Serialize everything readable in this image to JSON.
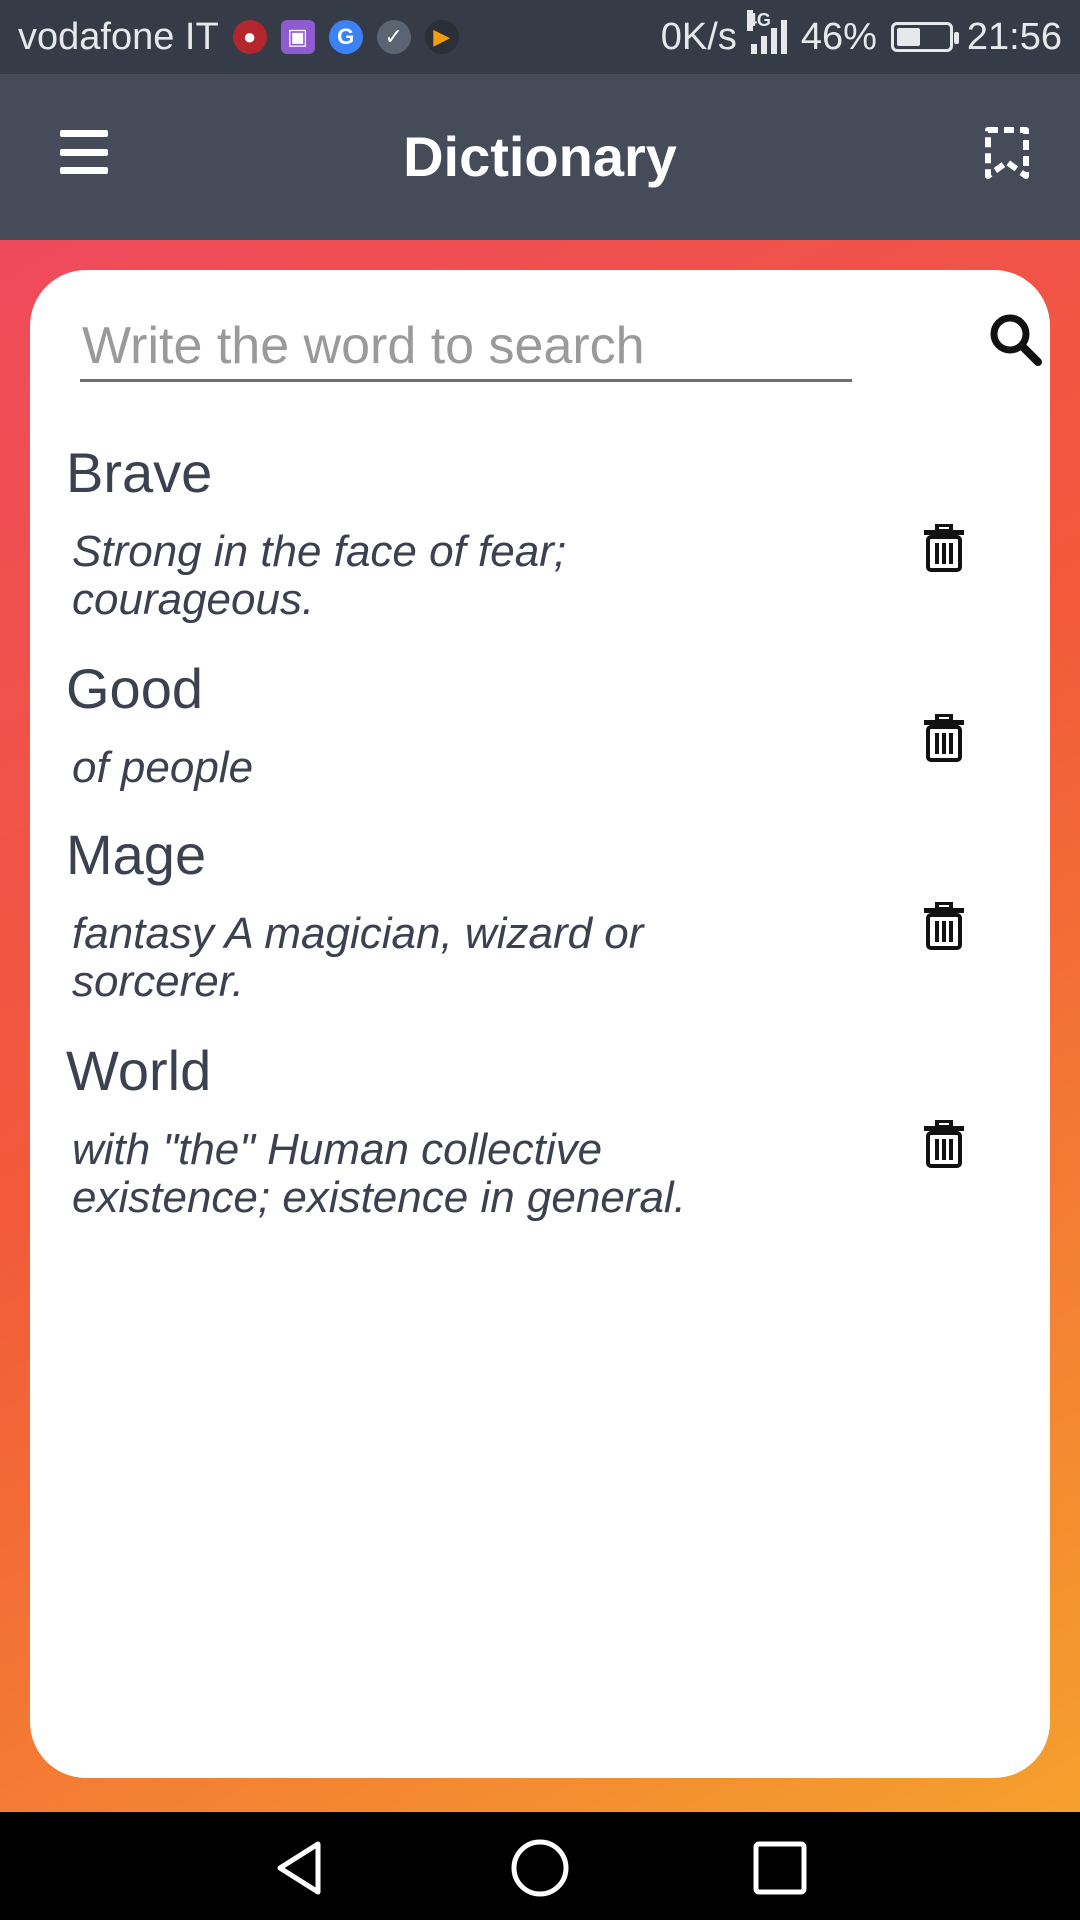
{
  "status_bar": {
    "carrier": "vodafone IT",
    "speed": "0K/s",
    "network": "4G",
    "battery": "46%",
    "battery_level": 0.46,
    "time": "21:56"
  },
  "app_bar": {
    "title": "Dictionary"
  },
  "search": {
    "placeholder": "Write the word to search",
    "value": ""
  },
  "entries": [
    {
      "word": "Brave",
      "definition": "Strong in the face of fear; courageous."
    },
    {
      "word": "Good",
      "definition": "of people"
    },
    {
      "word": "Mage",
      "definition": "fantasy A magician, wizard or sorcerer."
    },
    {
      "word": "World",
      "definition": "with \"the\" Human collective existence; existence in general."
    }
  ],
  "colors": {
    "status_bar_bg": "#353b47",
    "app_bar_bg": "#454b58",
    "gradient_start": "#ef4a5c",
    "gradient_end": "#f5a02d",
    "text": "#3c4150"
  }
}
